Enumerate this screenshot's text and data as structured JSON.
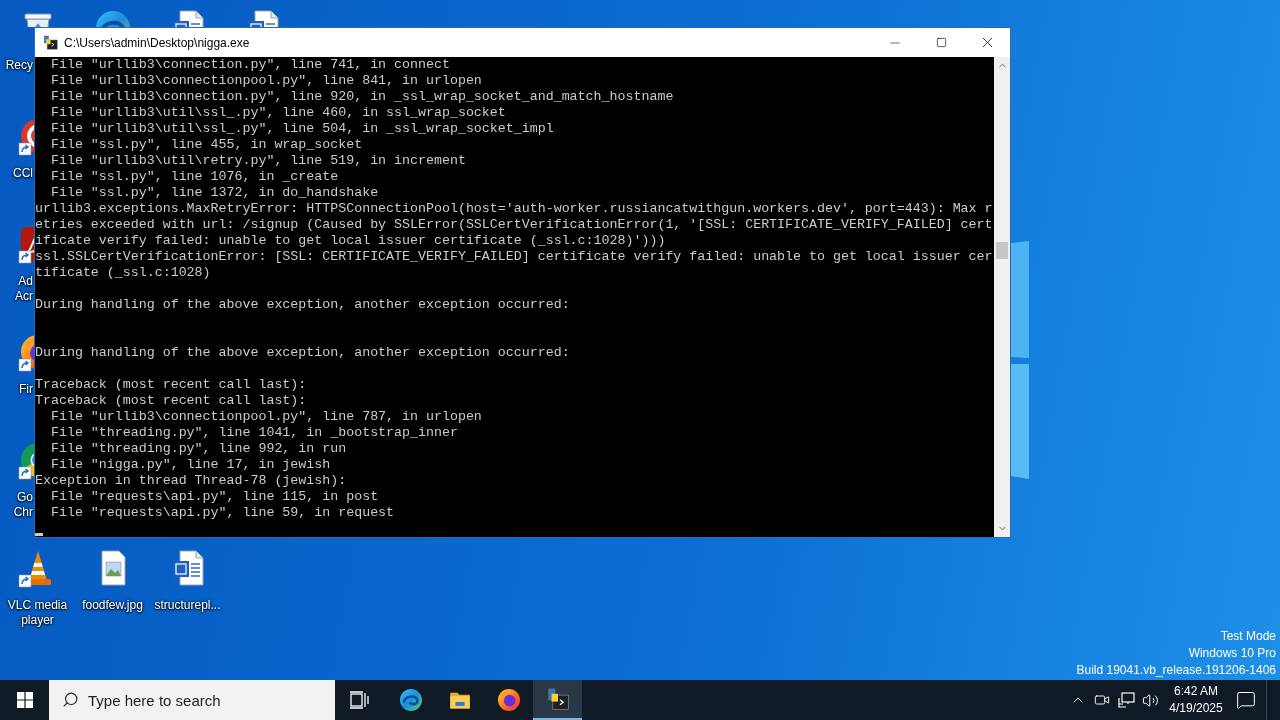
{
  "desktop": {
    "icons": [
      {
        "kind": "recycle-bin",
        "label_lines": [
          "Recy"
        ]
      },
      {
        "kind": "edge"
      },
      {
        "kind": "word"
      },
      {
        "kind": "word"
      },
      {
        "kind": "ccleaner",
        "shortcut": true,
        "label_lines": [
          "CCl"
        ]
      },
      {
        "kind": "acrobat",
        "shortcut": true,
        "label_lines": [
          "Ad",
          "Acr"
        ]
      },
      {
        "kind": "firefox",
        "shortcut": true,
        "label_lines": [
          "Fir"
        ]
      },
      {
        "kind": "chrome",
        "shortcut": true,
        "label_lines": [
          "Go",
          "Chr"
        ]
      },
      {
        "kind": "vlc",
        "shortcut": true,
        "label_lines": [
          "VLC media",
          "player"
        ]
      },
      {
        "kind": "image",
        "shortcut": false,
        "label_lines": [
          "foodfew.jpg"
        ]
      },
      {
        "kind": "word",
        "shortcut": false,
        "label_lines": [
          "structurepl..."
        ]
      }
    ],
    "notice": [
      "Test Mode",
      "Windows 10 Pro",
      "Build 19041.vb_release.191206-1406"
    ]
  },
  "window": {
    "title": "C:\\Users\\admin\\Desktop\\nigga.exe",
    "console": {
      "lines": [
        {
          "kind": "text",
          "text": "  File \"urllib3\\connection.py\", line 741, in connect"
        },
        {
          "kind": "text",
          "text": "  File \"urllib3\\connectionpool.py\", line 841, in urlopen"
        },
        {
          "kind": "text",
          "text": "  File \"urllib3\\connection.py\", line 920, in _ssl_wrap_socket_and_match_hostname"
        },
        {
          "kind": "text",
          "text": "  File \"urllib3\\util\\ssl_.py\", line 460, in ssl_wrap_socket"
        },
        {
          "kind": "text",
          "text": "  File \"urllib3\\util\\ssl_.py\", line 504, in _ssl_wrap_socket_impl"
        },
        {
          "kind": "text",
          "text": "  File \"ssl.py\", line 455, in wrap_socket"
        },
        {
          "kind": "text",
          "text": "  File \"urllib3\\util\\retry.py\", line 519, in increment"
        },
        {
          "kind": "text",
          "text": "  File \"ssl.py\", line 1076, in _create"
        },
        {
          "kind": "text",
          "text": "  File \"ssl.py\", line 1372, in do_handshake"
        },
        {
          "kind": "text",
          "text": "urllib3.exceptions.MaxRetryError: HTTPSConnectionPool(host='auth-worker.russiancatwithgun.workers.dev', port=443): Max r"
        },
        {
          "kind": "text",
          "text": "etries exceeded with url: /signup (Caused by SSLError(SSLCertVerificationError(1, '[SSL: CERTIFICATE_VERIFY_FAILED] cert"
        },
        {
          "kind": "text",
          "text": "ificate verify failed: unable to get local issuer certificate (_ssl.c:1028)')))"
        },
        {
          "kind": "text",
          "text": "ssl.SSLCertVerificationError: [SSL: CERTIFICATE_VERIFY_FAILED] certificate verify failed: unable to get local issuer cer"
        },
        {
          "kind": "text",
          "text": "tificate (_ssl.c:1028)"
        },
        {
          "kind": "blank"
        },
        {
          "kind": "text",
          "text": "During handling of the above exception, another exception occurred:"
        },
        {
          "kind": "blank"
        },
        {
          "kind": "blank"
        },
        {
          "kind": "text",
          "text": "During handling of the above exception, another exception occurred:"
        },
        {
          "kind": "blank"
        },
        {
          "kind": "text",
          "text": "Traceback (most recent call last):"
        },
        {
          "kind": "text",
          "text": "Traceback (most recent call last):"
        },
        {
          "kind": "text",
          "text": "  File \"urllib3\\connectionpool.py\", line 787, in urlopen"
        },
        {
          "kind": "text",
          "text": "  File \"threading.py\", line 1041, in _bootstrap_inner"
        },
        {
          "kind": "text",
          "text": "  File \"threading.py\", line 992, in run"
        },
        {
          "kind": "text",
          "text": "  File \"nigga.py\", line 17, in jewish"
        },
        {
          "kind": "text",
          "text": "Exception in thread Thread-78 (jewish):"
        },
        {
          "kind": "text",
          "text": "  File \"requests\\api.py\", line 115, in post"
        },
        {
          "kind": "text",
          "text": "  File \"requests\\api.py\", line 59, in request"
        },
        {
          "kind": "cursor"
        }
      ]
    }
  },
  "taskbar": {
    "search": {
      "placeholder": "Type here to search"
    },
    "apps": [
      {
        "kind": "edge",
        "selected": false
      },
      {
        "kind": "explorer",
        "selected": false
      },
      {
        "kind": "firefox",
        "selected": false
      },
      {
        "kind": "console",
        "selected": true
      }
    ],
    "clock": {
      "time": "6:42 AM",
      "date": "4/19/2025"
    }
  }
}
